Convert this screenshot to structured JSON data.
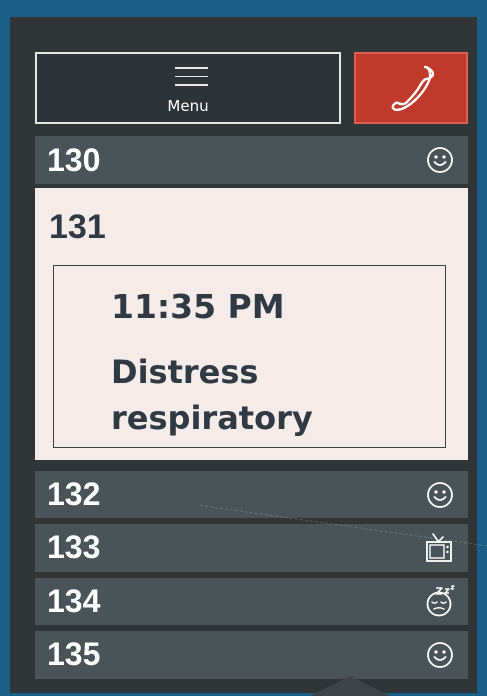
{
  "header": {
    "menu_label": "Menu",
    "menu_icon": "hamburger-icon",
    "call_icon": "phone-icon"
  },
  "rooms": [
    {
      "number": "130",
      "status_icon": "smiley-icon",
      "expanded": false
    },
    {
      "number": "131",
      "expanded": true,
      "alert": {
        "time": "11:35 PM",
        "message": "Distress respiratory"
      }
    },
    {
      "number": "132",
      "status_icon": "smiley-icon",
      "expanded": false
    },
    {
      "number": "133",
      "status_icon": "tv-icon",
      "expanded": false
    },
    {
      "number": "134",
      "status_icon": "sleeping-face-icon",
      "expanded": false
    },
    {
      "number": "135",
      "status_icon": "smiley-icon",
      "expanded": false
    }
  ],
  "colors": {
    "background": "#1c5f86",
    "panel": "#303638",
    "row": "#4a5357",
    "call_button": "#c03a2b",
    "expanded_card": "#f5ebe8",
    "text_dark": "#2f3a44"
  }
}
